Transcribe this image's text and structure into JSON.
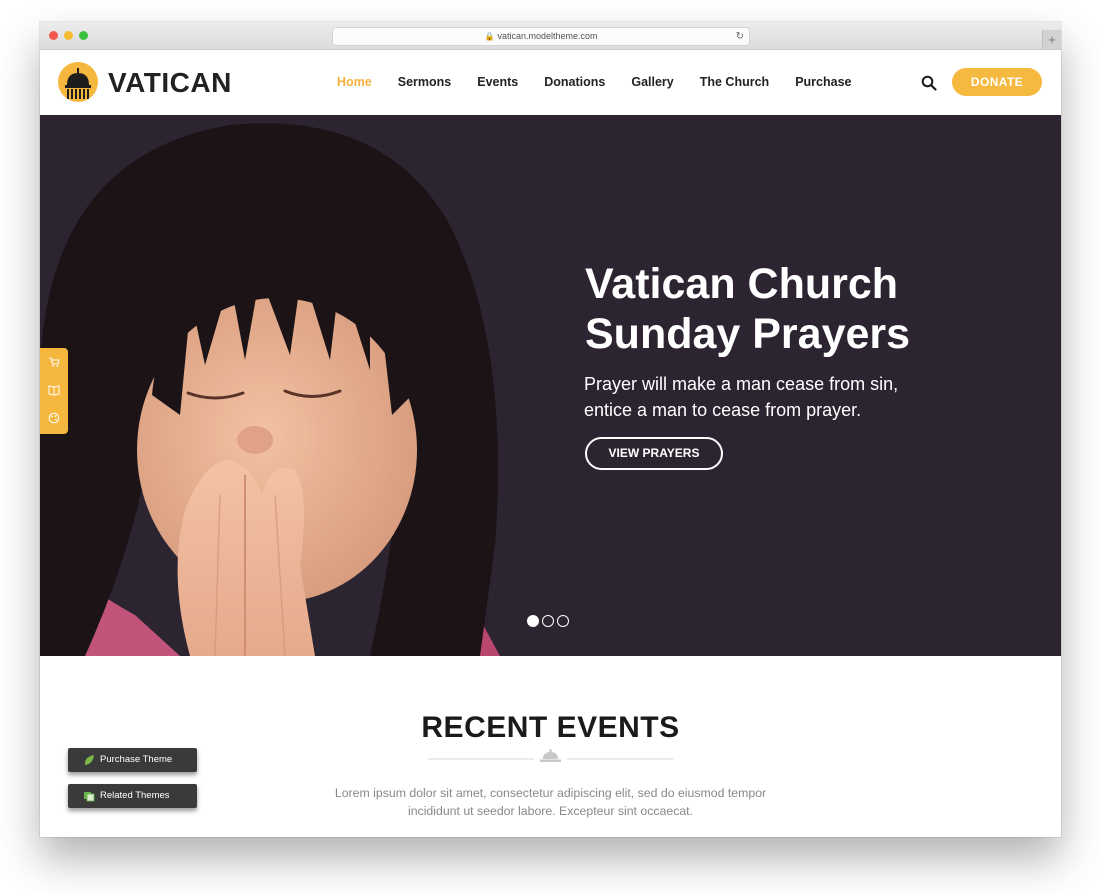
{
  "browser": {
    "url": "vatican.modeltheme.com"
  },
  "logo": {
    "text": "VATICAN"
  },
  "nav": [
    {
      "label": "Home",
      "active": true
    },
    {
      "label": "Sermons"
    },
    {
      "label": "Events"
    },
    {
      "label": "Donations"
    },
    {
      "label": "Gallery"
    },
    {
      "label": "The Church"
    },
    {
      "label": "Purchase"
    }
  ],
  "header": {
    "donate_label": "DONATE"
  },
  "hero": {
    "title_line1": "Vatican Church",
    "title_line2": "Sunday Prayers",
    "subtitle_line1": "Prayer will make a man cease from sin,",
    "subtitle_line2": "entice a man to cease from prayer.",
    "button_label": "VIEW PRAYERS",
    "slides": 3,
    "active_slide": 1
  },
  "events": {
    "title": "RECENT EVENTS",
    "text_line1": "Lorem ipsum dolor sit amet, consectetur adipiscing elit, sed do eiusmod tempor",
    "text_line2": "incididunt ut seedor labore. Excepteur sint occaecat."
  },
  "floating": {
    "purchase_label": "Purchase Theme",
    "related_label": "Related Themes"
  },
  "colors": {
    "accent": "#f5b73e",
    "hero_bg": "#2c2431",
    "chrome": "#e3e3e3"
  },
  "icons": [
    "search-icon",
    "cart-icon",
    "book-icon",
    "palette-icon",
    "leaf-icon",
    "themes-icon",
    "dome-icon"
  ]
}
